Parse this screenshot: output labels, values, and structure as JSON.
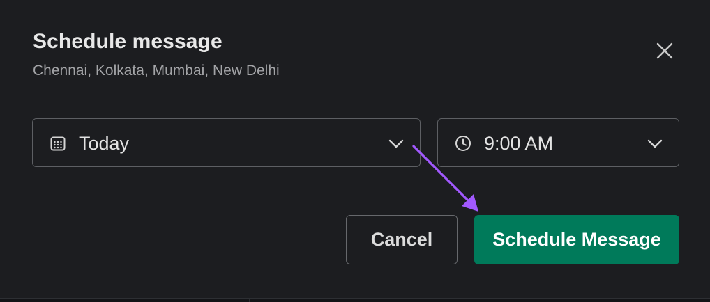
{
  "dialog": {
    "title": "Schedule message",
    "subtitle": "Chennai, Kolkata, Mumbai, New Delhi",
    "close_icon": "close-icon"
  },
  "date_select": {
    "icon": "calendar-icon",
    "value": "Today",
    "chevron_icon": "chevron-down-icon"
  },
  "time_select": {
    "icon": "clock-icon",
    "value": "9:00 AM",
    "chevron_icon": "chevron-down-icon"
  },
  "actions": {
    "cancel_label": "Cancel",
    "schedule_label": "Schedule Message"
  },
  "annotation": {
    "icon": "arrow-annotation",
    "color": "#a259ff"
  },
  "colors": {
    "background": "#1c1d20",
    "primary_button": "#007a5a",
    "accent_arrow": "#a259ff"
  }
}
